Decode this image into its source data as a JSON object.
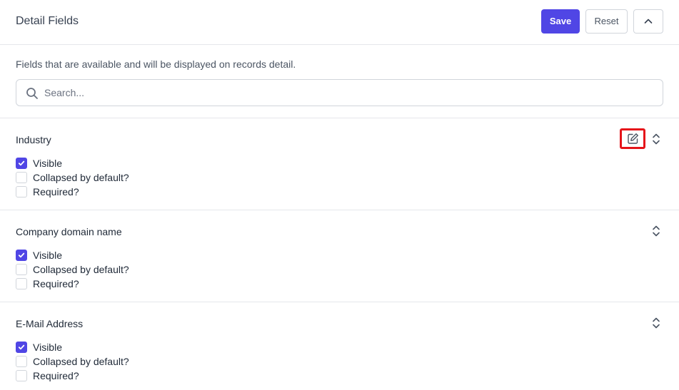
{
  "header": {
    "title": "Detail Fields",
    "save_label": "Save",
    "reset_label": "Reset",
    "collapse_icon": "chevron-up-icon"
  },
  "description": "Fields that are available and will be displayed on records detail.",
  "search": {
    "placeholder": "Search...",
    "value": "",
    "icon": "search-icon"
  },
  "fields": [
    {
      "name": "Industry",
      "show_edit": true,
      "options": [
        {
          "label": "Visible",
          "checked": true
        },
        {
          "label": "Collapsed by default?",
          "checked": false
        },
        {
          "label": "Required?",
          "checked": false
        }
      ]
    },
    {
      "name": "Company domain name",
      "show_edit": false,
      "options": [
        {
          "label": "Visible",
          "checked": true
        },
        {
          "label": "Collapsed by default?",
          "checked": false
        },
        {
          "label": "Required?",
          "checked": false
        }
      ]
    },
    {
      "name": "E-Mail Address",
      "show_edit": false,
      "options": [
        {
          "label": "Visible",
          "checked": true
        },
        {
          "label": "Collapsed by default?",
          "checked": false
        },
        {
          "label": "Required?",
          "checked": false
        }
      ]
    }
  ],
  "colors": {
    "accent": "#5046e5",
    "highlight": "#e5141a",
    "border": "#e5e7eb"
  }
}
